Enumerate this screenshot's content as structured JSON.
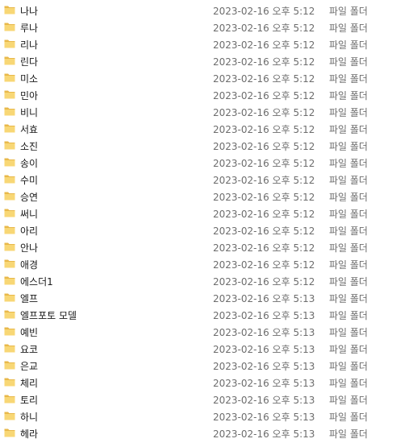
{
  "files": [
    {
      "name": "나나",
      "date": "2023-02-16 오후 5:12",
      "type": "파일 폴더",
      "icon": "folder-icon"
    },
    {
      "name": "루나",
      "date": "2023-02-16 오후 5:12",
      "type": "파일 폴더",
      "icon": "folder-icon"
    },
    {
      "name": "리나",
      "date": "2023-02-16 오후 5:12",
      "type": "파일 폴더",
      "icon": "folder-icon"
    },
    {
      "name": "린다",
      "date": "2023-02-16 오후 5:12",
      "type": "파일 폴더",
      "icon": "folder-icon"
    },
    {
      "name": "미소",
      "date": "2023-02-16 오후 5:12",
      "type": "파일 폴더",
      "icon": "folder-icon"
    },
    {
      "name": "민아",
      "date": "2023-02-16 오후 5:12",
      "type": "파일 폴더",
      "icon": "folder-icon"
    },
    {
      "name": "비니",
      "date": "2023-02-16 오후 5:12",
      "type": "파일 폴더",
      "icon": "folder-icon"
    },
    {
      "name": "서효",
      "date": "2023-02-16 오후 5:12",
      "type": "파일 폴더",
      "icon": "folder-icon"
    },
    {
      "name": "소진",
      "date": "2023-02-16 오후 5:12",
      "type": "파일 폴더",
      "icon": "folder-icon"
    },
    {
      "name": "송이",
      "date": "2023-02-16 오후 5:12",
      "type": "파일 폴더",
      "icon": "folder-icon"
    },
    {
      "name": "수미",
      "date": "2023-02-16 오후 5:12",
      "type": "파일 폴더",
      "icon": "folder-icon"
    },
    {
      "name": "승연",
      "date": "2023-02-16 오후 5:12",
      "type": "파일 폴더",
      "icon": "folder-icon"
    },
    {
      "name": "써니",
      "date": "2023-02-16 오후 5:12",
      "type": "파일 폴더",
      "icon": "folder-icon"
    },
    {
      "name": "아리",
      "date": "2023-02-16 오후 5:12",
      "type": "파일 폴더",
      "icon": "folder-icon"
    },
    {
      "name": "안나",
      "date": "2023-02-16 오후 5:12",
      "type": "파일 폴더",
      "icon": "folder-icon"
    },
    {
      "name": "애경",
      "date": "2023-02-16 오후 5:12",
      "type": "파일 폴더",
      "icon": "folder-icon"
    },
    {
      "name": "에스더1",
      "date": "2023-02-16 오후 5:12",
      "type": "파일 폴더",
      "icon": "folder-icon"
    },
    {
      "name": "엘프",
      "date": "2023-02-16 오후 5:13",
      "type": "파일 폴더",
      "icon": "folder-icon"
    },
    {
      "name": "엘프포토 모델",
      "date": "2023-02-16 오후 5:13",
      "type": "파일 폴더",
      "icon": "folder-icon"
    },
    {
      "name": "예빈",
      "date": "2023-02-16 오후 5:13",
      "type": "파일 폴더",
      "icon": "folder-icon"
    },
    {
      "name": "요코",
      "date": "2023-02-16 오후 5:13",
      "type": "파일 폴더",
      "icon": "folder-icon"
    },
    {
      "name": "은교",
      "date": "2023-02-16 오후 5:13",
      "type": "파일 폴더",
      "icon": "folder-icon"
    },
    {
      "name": "체리",
      "date": "2023-02-16 오후 5:13",
      "type": "파일 폴더",
      "icon": "folder-icon"
    },
    {
      "name": "토리",
      "date": "2023-02-16 오후 5:13",
      "type": "파일 폴더",
      "icon": "folder-icon"
    },
    {
      "name": "하니",
      "date": "2023-02-16 오후 5:13",
      "type": "파일 폴더",
      "icon": "folder-icon"
    },
    {
      "name": "헤라",
      "date": "2023-02-16 오후 5:13",
      "type": "파일 폴더",
      "icon": "folder-icon"
    }
  ],
  "colors": {
    "folder_body": "#f8d775",
    "folder_tab": "#e8b84a",
    "name_text": "#1a1a1a",
    "meta_text": "#6d6d6d"
  }
}
